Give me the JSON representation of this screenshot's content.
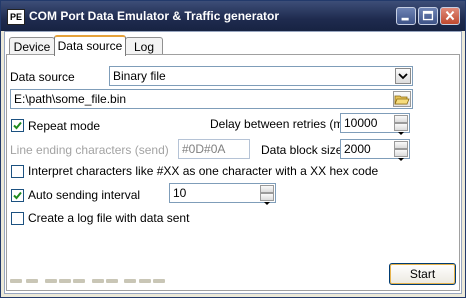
{
  "window": {
    "title": "COM Port Data Emulator & Traffic generator",
    "icon_text": "PE"
  },
  "tabs": [
    {
      "label": "Device",
      "active": false
    },
    {
      "label": "Data source",
      "active": true
    },
    {
      "label": "Log",
      "active": false
    }
  ],
  "form": {
    "data_source_label": "Data source",
    "data_source_value": "Binary file",
    "file_path": "E:\\path\\some_file.bin",
    "repeat_mode_label": "Repeat mode",
    "repeat_mode_checked": true,
    "delay_label": "Delay between retries (ms)",
    "delay_value": "10000",
    "line_ending_label": "Line ending characters (send)",
    "line_ending_value": "#0D#0A",
    "block_size_label": "Data block size",
    "block_size_value": "2000",
    "interpret_label": "Interpret characters like #XX as one character with a XX hex code",
    "interpret_checked": false,
    "auto_send_label": "Auto sending interval",
    "auto_send_checked": true,
    "auto_send_value": "10",
    "log_file_label": "Create a log file with data sent",
    "log_file_checked": false
  },
  "buttons": {
    "start": "Start"
  },
  "colors": {
    "titlebar": "#1f2b4f",
    "tab_accent": "#e6a23a",
    "field_border": "#7f9db9"
  }
}
